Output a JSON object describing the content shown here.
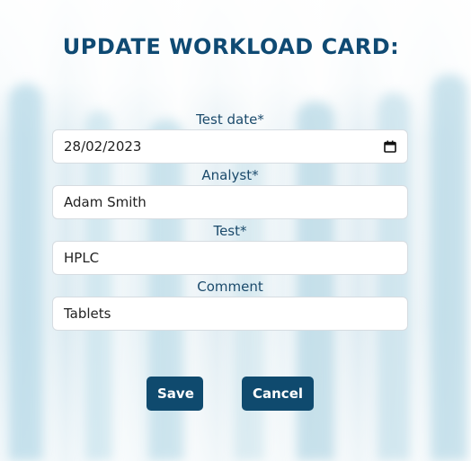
{
  "title": "UPDATE WORKLOAD CARD:",
  "form": {
    "fields": [
      {
        "label": "Test date*",
        "value": "28/02/2023",
        "icon": "calendar-icon"
      },
      {
        "label": "Analyst*",
        "value": "Adam Smith"
      },
      {
        "label": "Test*",
        "value": "HPLC"
      },
      {
        "label": "Comment",
        "value": "Tablets"
      }
    ]
  },
  "actions": {
    "save_label": "Save",
    "cancel_label": "Cancel"
  },
  "colors": {
    "accent": "#0f4a6e",
    "title": "#0f4a73",
    "label": "#1b4a6b"
  }
}
